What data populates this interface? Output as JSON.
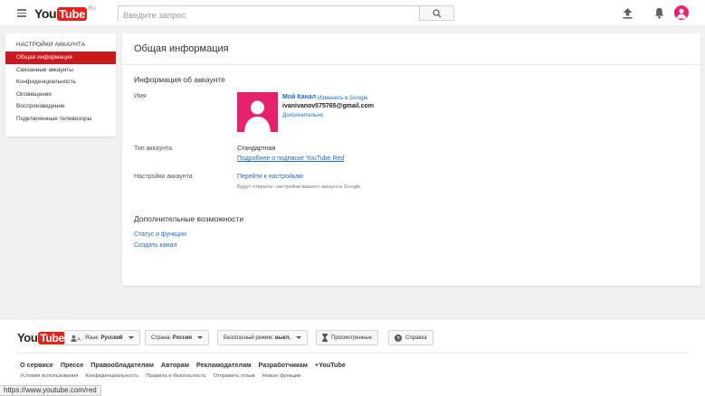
{
  "header": {
    "logo_you": "You",
    "logo_tube": "Tube",
    "logo_region": "RU",
    "search_placeholder": "Введите запрос"
  },
  "icons": {
    "menu": "menu-icon",
    "search": "search-icon",
    "upload": "upload-icon",
    "bell": "bell-icon",
    "avatar": "avatar"
  },
  "sidebar": {
    "title": "НАСТРОЙКИ АККАУНТА",
    "items": [
      {
        "label": "Общая информация",
        "active": true
      },
      {
        "label": "Связанные аккаунты"
      },
      {
        "label": "Конфиденциальность"
      },
      {
        "label": "Оповещения"
      },
      {
        "label": "Воспроизведение"
      },
      {
        "label": "Подключенные телевизоры"
      }
    ]
  },
  "main": {
    "title": "Общая информация",
    "account_info": {
      "section_title": "Информация об аккаунте",
      "name_label": "Имя",
      "channel_name": "Мой Канал",
      "channel_edit": "Изменить в Google",
      "email": "ivanivanov575765@gmail.com",
      "more": "Дополнительно",
      "type_label": "Тип аккаунта",
      "type_value": "Стандартная",
      "type_link": "Подробнее о подписке YouTube Red",
      "settings_label": "Настройки аккаунта",
      "settings_link": "Перейти к настройкам",
      "settings_note": "Будут открыты: настройки вашего аккаунта Google."
    },
    "extra": {
      "section_title": "Дополнительные возможности",
      "links": [
        "Статус и функции",
        "Создать канал"
      ]
    }
  },
  "footer": {
    "language": {
      "label": "Язык:",
      "value": "Русский"
    },
    "country": {
      "label": "Страна:",
      "value": "Россия"
    },
    "safe_mode": {
      "label": "Безопасный режим:",
      "value": "выкл."
    },
    "history": "Просмотренные",
    "help": "Справка",
    "links_primary": [
      "О сервисе",
      "Прессе",
      "Правообладателям",
      "Авторам",
      "Рекламодателям",
      "Разработчикам",
      "+YouTube"
    ],
    "links_secondary": [
      "Условия использования",
      "Конфиденциальность",
      "Правила и безопасность",
      "Отправить отзыв",
      "Новые функции"
    ]
  },
  "statusbar": {
    "url": "https://www.youtube.com/red"
  },
  "colors": {
    "brand_red": "#e62117",
    "active_red": "#cc181e",
    "link_blue": "#1b6ac9",
    "avatar_pink": "#e5226b"
  }
}
